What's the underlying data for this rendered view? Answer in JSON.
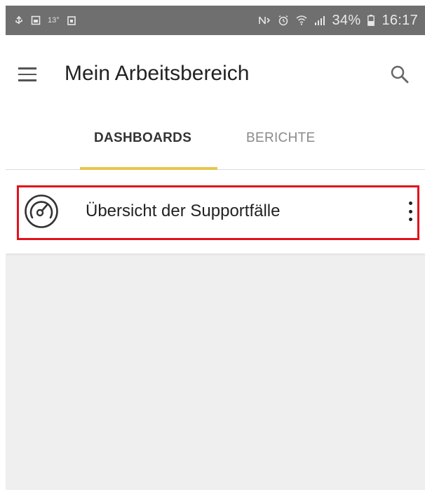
{
  "status_bar": {
    "notif_text": "13°",
    "battery": "34%",
    "time": "16:17"
  },
  "app_bar": {
    "title": "Mein Arbeitsbereich"
  },
  "tabs": [
    {
      "label": "DASHBOARDS",
      "selected": true
    },
    {
      "label": "BERICHTE",
      "selected": false
    }
  ],
  "accent_color": "#e8c54a",
  "highlight_color": "#e2121c",
  "dashboards": [
    {
      "label": "Übersicht der Supportfälle",
      "icon": "gauge-icon"
    }
  ]
}
